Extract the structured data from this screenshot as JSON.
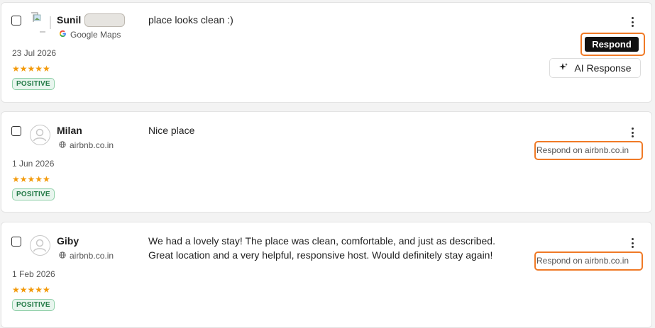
{
  "reviews": [
    {
      "name": "Sunil N",
      "source": "Google Maps",
      "date": "23 Jul 2026",
      "stars": "★★★★★",
      "sentiment": "POSITIVE",
      "text": "place looks clean :)",
      "respond_label": "Respond",
      "ai_label": "AI Response"
    },
    {
      "name": "Milan",
      "source": "airbnb.co.in",
      "date": "1 Jun 2026",
      "stars": "★★★★★",
      "sentiment": "POSITIVE",
      "text": "Nice place",
      "respond_label": "Respond on airbnb.co.in"
    },
    {
      "name": "Giby",
      "source": "airbnb.co.in",
      "date": "1 Feb 2026",
      "stars": "★★★★★",
      "sentiment": "POSITIVE",
      "text_line1": "We had a lovely stay! The place was clean, comfortable, and just as described.",
      "text_line2": "Great location and a very helpful, responsive host. Would definitely stay again!",
      "respond_label": "Respond on airbnb.co.in"
    }
  ],
  "colors": {
    "accent_highlight": "#f07a26",
    "star": "#f39a0b",
    "positive_bg": "#e8f5ee",
    "positive_text": "#237a47",
    "button_dark": "#111111"
  },
  "icons": [
    "broken-image-icon",
    "google-g-icon",
    "globe-icon",
    "user-icon",
    "sparkle-icon",
    "kebab-menu-icon"
  ]
}
